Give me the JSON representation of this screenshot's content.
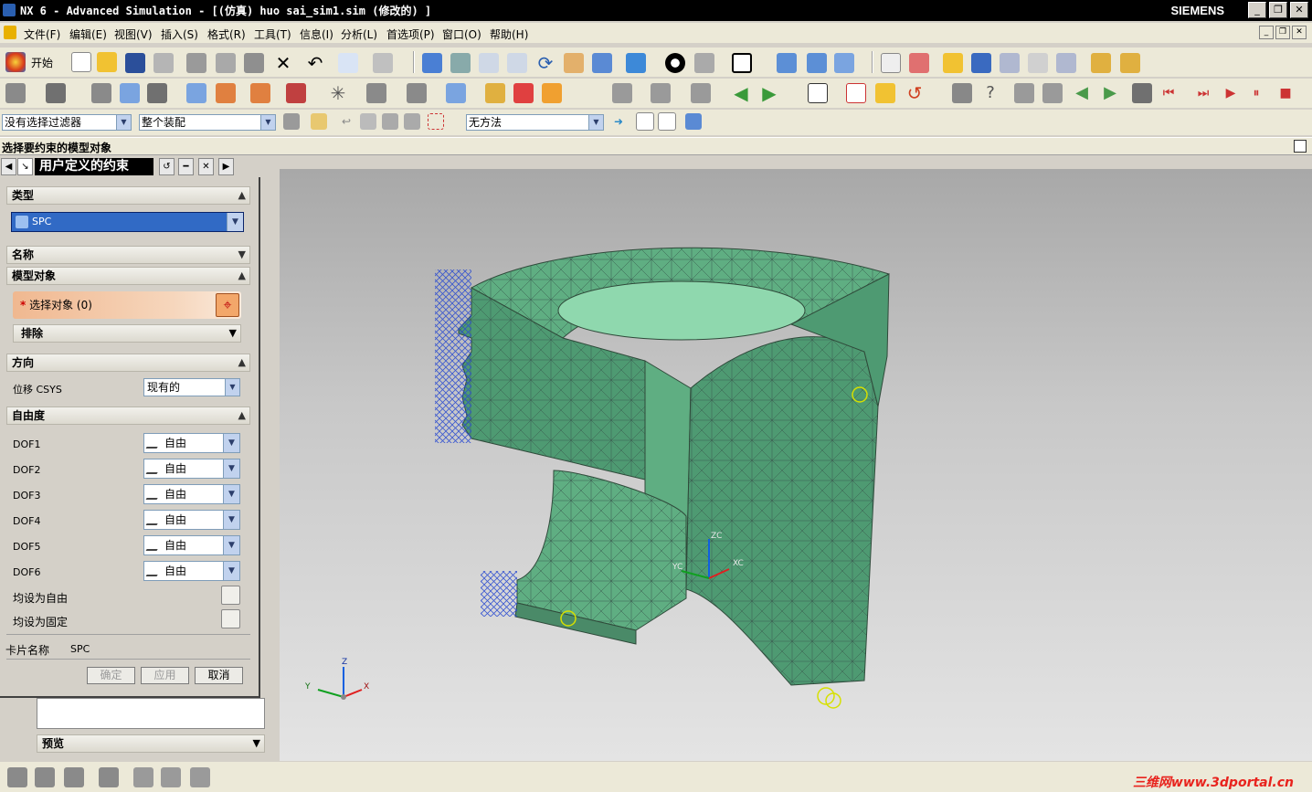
{
  "window": {
    "title": "NX 6 - Advanced Simulation - [(仿真) huo sai_sim1.sim  (修改的) ]",
    "brand": "SIEMENS"
  },
  "menu": [
    "文件(F)",
    "编辑(E)",
    "视图(V)",
    "插入(S)",
    "格式(R)",
    "工具(T)",
    "信息(I)",
    "分析(L)",
    "首选项(P)",
    "窗口(O)",
    "帮助(H)"
  ],
  "toolbar": {
    "start_label": "开始",
    "filter_value": "没有选择过滤器",
    "assembly_value": "整个装配",
    "method_value": "无方法"
  },
  "cue": "选择要约束的模型对象",
  "dialog": {
    "title": "用户定义的约束",
    "type_section": "类型",
    "type_value": "SPC",
    "name_section": "名称",
    "model_section": "模型对象",
    "select_label": "选择对象  (0)",
    "exclude_label": "排除",
    "direction_section": "方向",
    "csys_label": "位移 CSYS",
    "csys_value": "现有的",
    "dof_section": "自由度",
    "dofs": [
      {
        "label": "DOF1",
        "value": "自由"
      },
      {
        "label": "DOF2",
        "value": "自由"
      },
      {
        "label": "DOF3",
        "value": "自由"
      },
      {
        "label": "DOF4",
        "value": "自由"
      },
      {
        "label": "DOF5",
        "value": "自由"
      },
      {
        "label": "DOF6",
        "value": "自由"
      }
    ],
    "set_free": "均设为自由",
    "set_fixed": "均设为固定",
    "card_label": "卡片名称",
    "card_value": "SPC",
    "ok": "确定",
    "apply": "应用",
    "cancel": "取消"
  },
  "background_panel": {
    "preview": "预览"
  },
  "viewport": {
    "axis_x": "XC",
    "axis_y": "YC",
    "axis_z": "ZC",
    "triad_x": "X",
    "triad_y": "Y",
    "triad_z": "Z",
    "mesh_color": "#4d9a72"
  },
  "watermark": "三维网www.3dportal.cn"
}
